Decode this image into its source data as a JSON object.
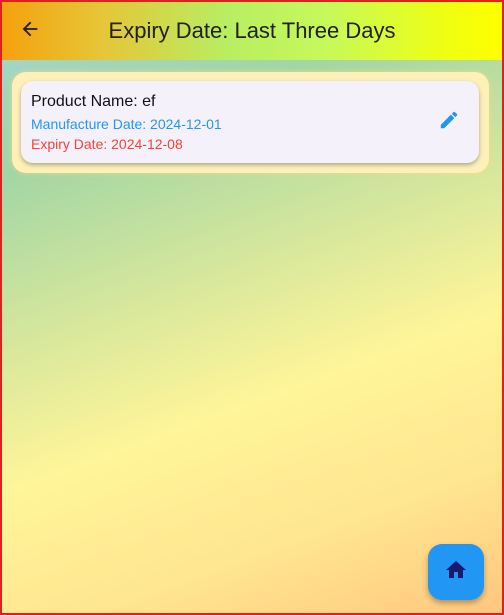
{
  "appbar": {
    "title": "Expiry Date: Last Three Days",
    "back_icon": "arrow-back-icon"
  },
  "products": [
    {
      "name_text": "Product Name: ef",
      "manufacture_text": "Manufacture Date: 2024-12-01",
      "expiry_text": "Expiry Date: 2024-12-08",
      "edit_icon": "pencil-icon"
    }
  ],
  "fab": {
    "icon": "home-icon"
  },
  "colors": {
    "manufacture": "#2196f3",
    "expiry": "#f44336",
    "fab": "#2196f3",
    "border": "#e0201c"
  }
}
